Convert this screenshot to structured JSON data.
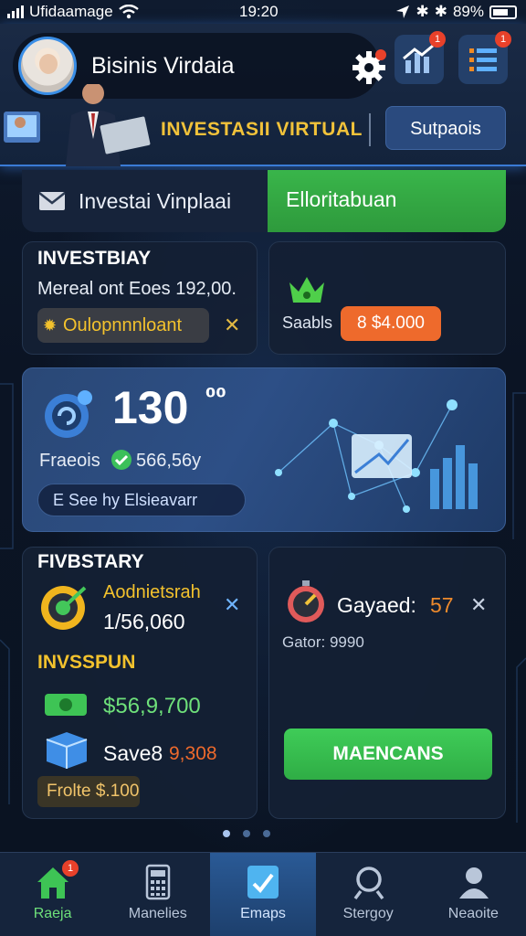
{
  "status_bar": {
    "carrier": "Ufidaamage",
    "time": "19:20",
    "battery": "89%"
  },
  "header": {
    "profile_name": "Bisinis Virdaia",
    "settings_badge": "",
    "chart_badge": "1",
    "menu_badge": "1",
    "promo_title": "INVESTASII VIRTUAL",
    "promo_button": "Sutpaois"
  },
  "tabs": {
    "left_label": "Investai Vinplaai",
    "right_label": "Elloritabuan"
  },
  "card_invest": {
    "title": "INVESTBIAY",
    "line": "Mereal ont Eoes 192,00.",
    "pill": "Oulopnnnloant"
  },
  "card_sales": {
    "label": "Saabls",
    "pill": "8 $4.000"
  },
  "hero": {
    "value": "130",
    "value_suffix": "⁰⁰",
    "profit_label": "Fraeois",
    "profit_value": "566,56y",
    "pill": "E See hy Elsieavarr"
  },
  "card_fivestar": {
    "title": "FIVBSTARY",
    "item_label": "Aodnietsrah",
    "item_value": "1/56,060",
    "subtitle": "INVSSPUN",
    "money_value": "$56,9,700",
    "save_label": "Save8",
    "save_value": "9,308",
    "pill": "Frolte $.100"
  },
  "card_gayaed": {
    "label": "Gayaed:",
    "value": "57",
    "sub": "Gator: 9990",
    "button": "MAENCANS"
  },
  "bottom_nav": {
    "items": [
      {
        "label": "Raeja",
        "badge": "1"
      },
      {
        "label": "Manelies"
      },
      {
        "label": "Emaps"
      },
      {
        "label": "Stergoy"
      },
      {
        "label": "Neaoite"
      }
    ]
  },
  "colors": {
    "accent_blue": "#3a7bd5",
    "accent_green": "#39b54a",
    "accent_orange": "#ee6a2c",
    "accent_yellow": "#f1c23a",
    "badge_red": "#e8412a"
  }
}
